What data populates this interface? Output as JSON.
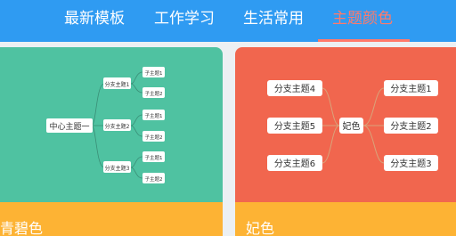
{
  "tabs": [
    {
      "label": "最新模板",
      "active": false
    },
    {
      "label": "工作学习",
      "active": false
    },
    {
      "label": "生活常用",
      "active": false
    },
    {
      "label": "主题颜色",
      "active": true
    }
  ],
  "colors": {
    "header": "#2f9bf2",
    "active_tab": "#ff7a6b",
    "card_teal": "#4fc2a1",
    "card_red": "#f1664e",
    "footer": "#fdb334"
  },
  "cards": [
    {
      "title": "青碧色",
      "center": "中心主题一",
      "branches": [
        {
          "label": "分支主题1",
          "subs": [
            "子主题1",
            "子主题2"
          ]
        },
        {
          "label": "分支主题2",
          "subs": [
            "子主题1",
            "子主题2"
          ]
        },
        {
          "label": "分支主题3",
          "subs": [
            "子主题1",
            "子主题2"
          ]
        }
      ]
    },
    {
      "title": "妃色",
      "center": "妃色",
      "left_branches": [
        "分支主题4",
        "分支主题5",
        "分支主题6"
      ],
      "right_branches": [
        "分支主题1",
        "分支主题2",
        "分支主题3"
      ]
    }
  ]
}
